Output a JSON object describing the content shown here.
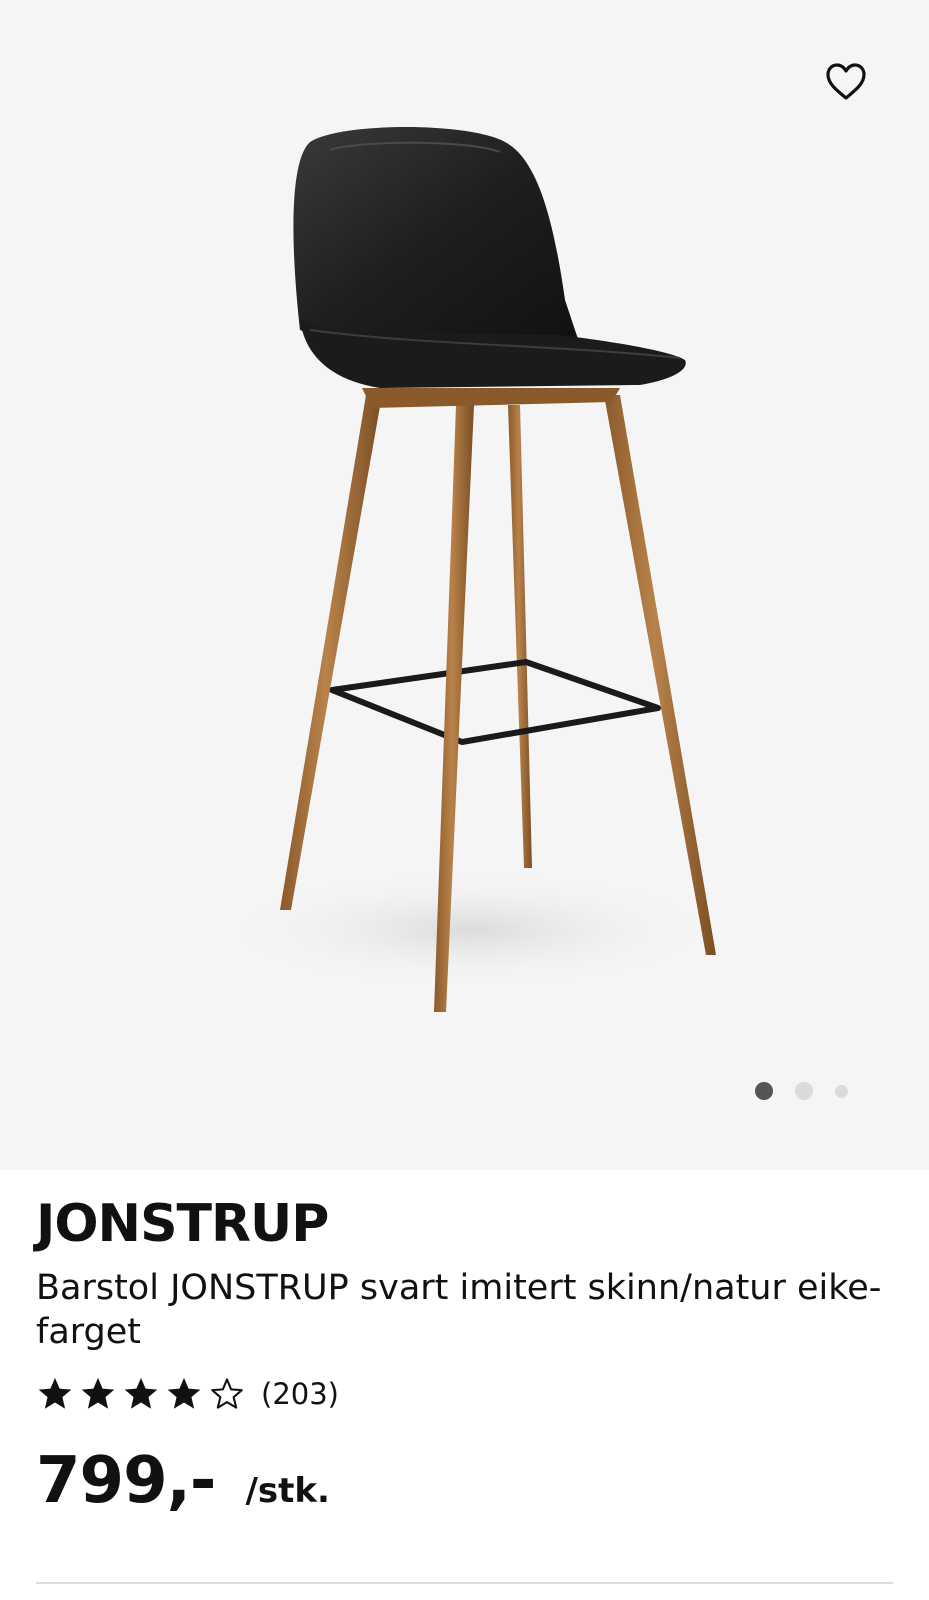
{
  "gallery": {
    "image_alt": "Barstol JONSTRUP",
    "favorite_icon": "heart-outline-icon",
    "dots_total": 3,
    "dots_active": 1
  },
  "product": {
    "name": "JONSTRUP",
    "description": "Barstol JONSTRUP svart imitert skinn/natur eike-farget",
    "rating": {
      "value": 4,
      "max": 5,
      "count_label": "(203)"
    },
    "price": "799,-",
    "unit": "/stk."
  },
  "colors": {
    "background": "#f5f5f5",
    "text": "#111111",
    "dot_active": "#555555",
    "dot_inactive": "#dadada"
  }
}
